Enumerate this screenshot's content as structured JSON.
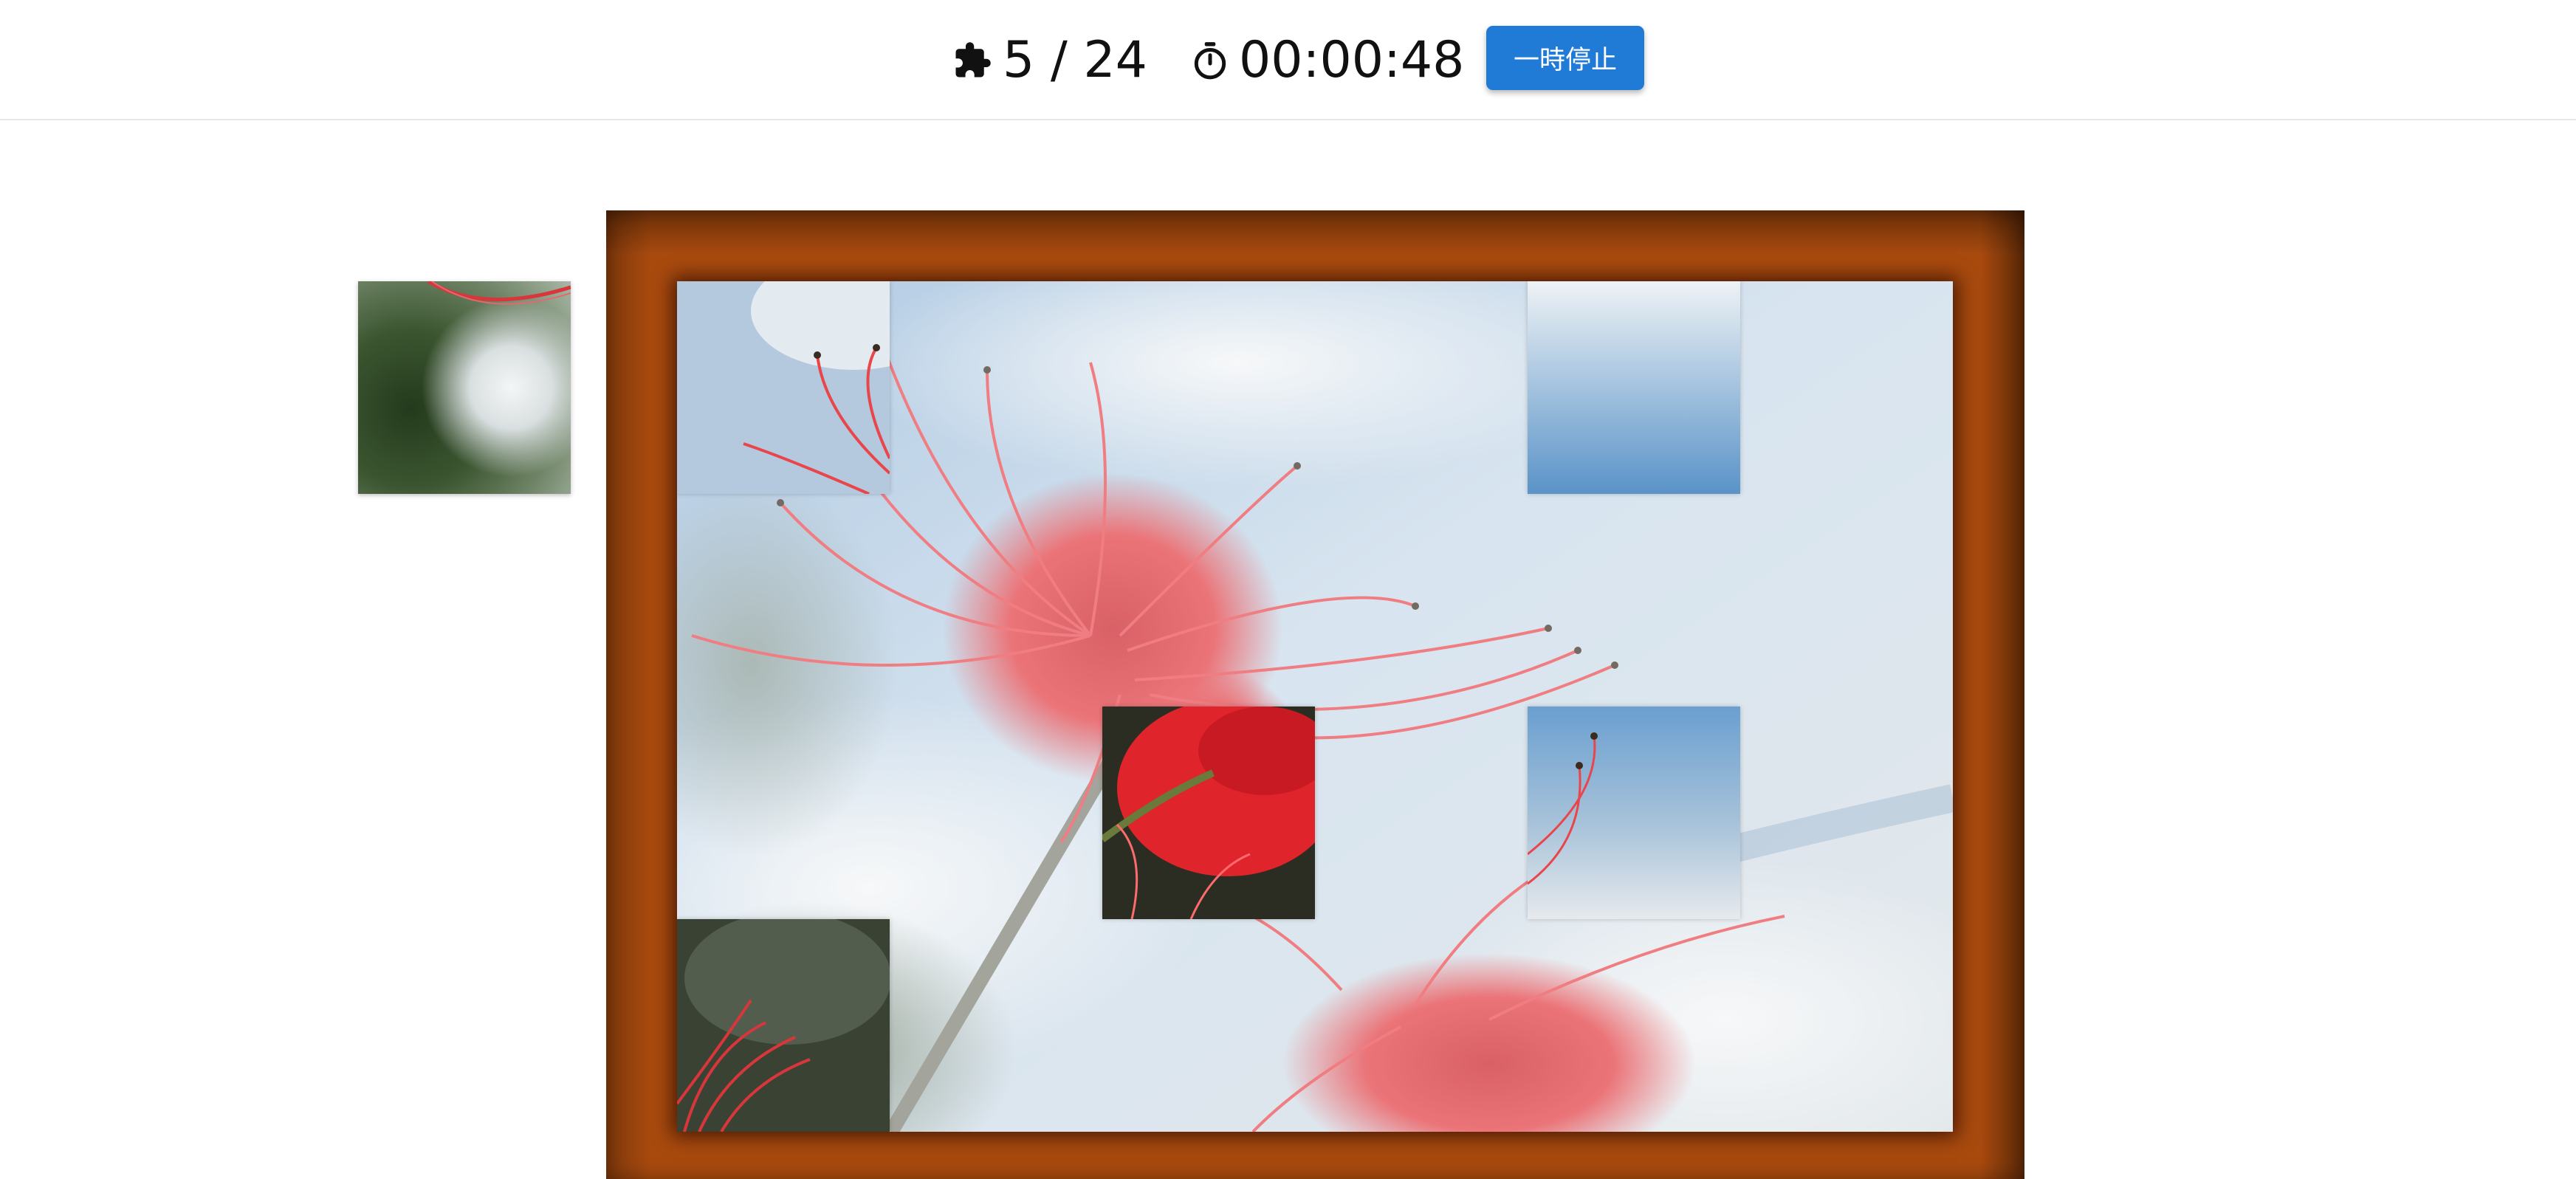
{
  "header": {
    "pieces_icon": "puzzle-piece-icon",
    "pieces_progress": "5 / 24",
    "timer_icon": "stopwatch-icon",
    "timer_value": "00:00:48",
    "pause_label": "一時停止"
  },
  "puzzle": {
    "placed": 5,
    "total": 24,
    "image_subject": "red spider lily against blue sky"
  },
  "colors": {
    "accent": "#1f7bd6",
    "frame": "#a84a0e",
    "flower": "#e0242b"
  }
}
